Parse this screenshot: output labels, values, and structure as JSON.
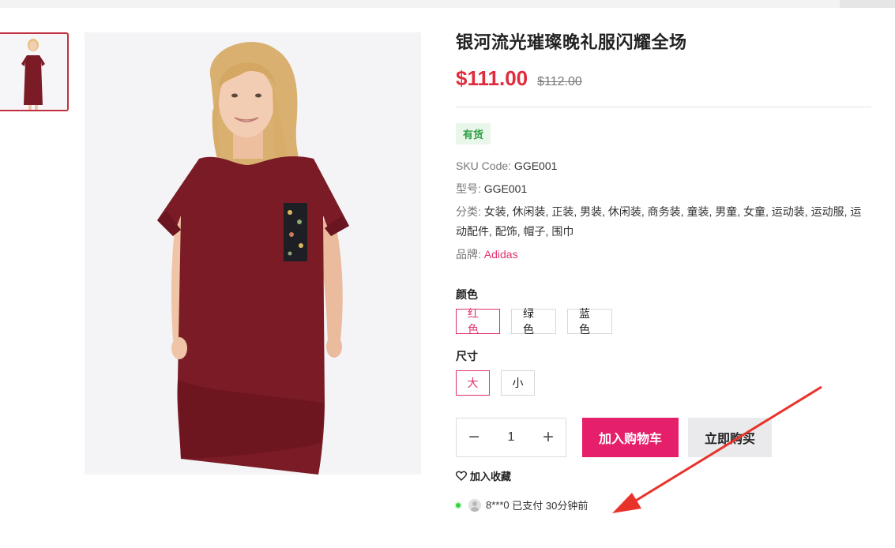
{
  "product": {
    "title": "银河流光璀璨晚礼服闪耀全场",
    "price": "$111.00",
    "old_price": "$112.00",
    "stock_label": "有货",
    "dress_color": "#7a1b25",
    "accent_color": "#e61f6a"
  },
  "meta": {
    "sku_key": "SKU Code:",
    "sku_value": " GGE001",
    "model_key": "型号:",
    "model_value": " GGE001",
    "category_key": "分类:",
    "category_value": " 女装, 休闲装, 正装, 男装, 休闲装, 商务装, 童装, 男童, 女童, 运动装, 运动服, 运动配件, 配饰, 帽子, 围巾",
    "brand_key": "品牌:",
    "brand_value": "Adidas"
  },
  "options": {
    "color_label": "颜色",
    "colors": [
      "红色",
      "绿色",
      "蓝色"
    ],
    "selected_color": "红色",
    "size_label": "尺寸",
    "sizes": [
      "大",
      "小"
    ],
    "selected_size": "大"
  },
  "purchase": {
    "minus": "−",
    "quantity": "1",
    "plus": "+",
    "add_to_cart": "加入购物车",
    "buy_now": "立即购买"
  },
  "wishlist": {
    "label": "加入收藏",
    "icon": "heart-icon"
  },
  "activity": {
    "buyer": "8***0",
    "action": "已支付",
    "time": "30分钟前"
  }
}
